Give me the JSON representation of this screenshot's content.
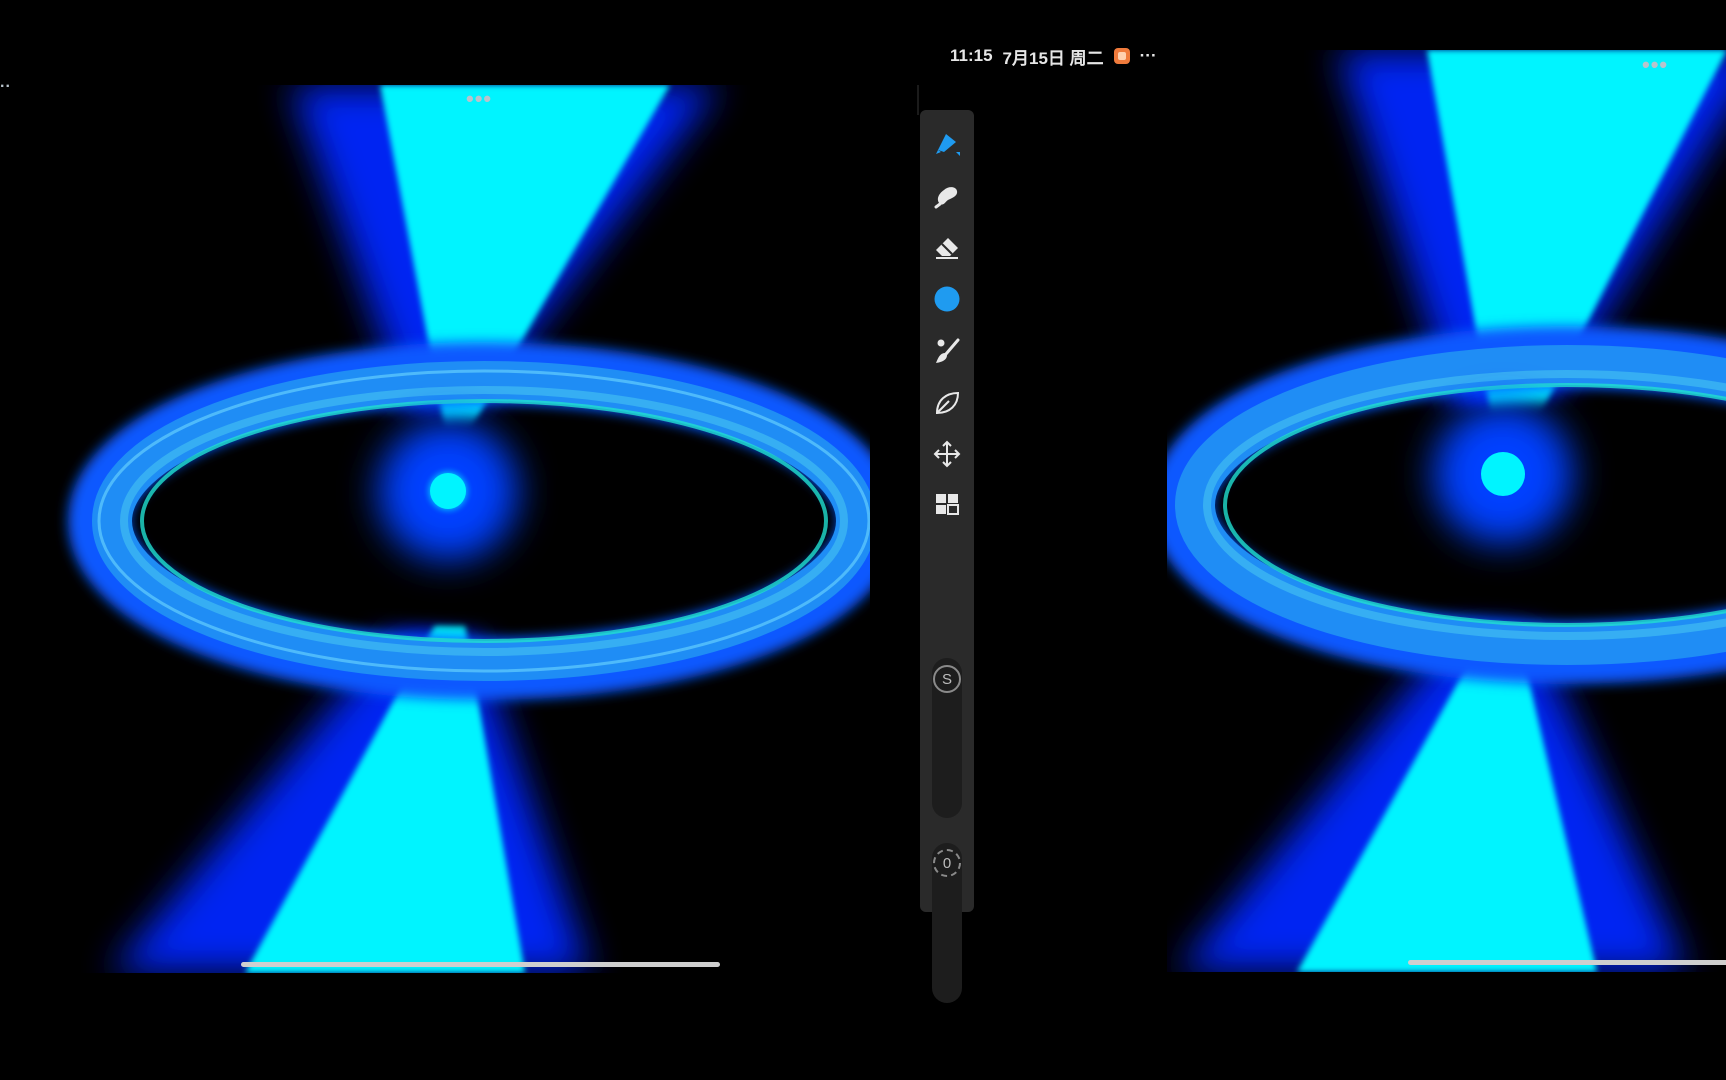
{
  "status_bar": {
    "time": "11:15",
    "date": "7月15日 周二",
    "more": "···"
  },
  "left_pane": {
    "more_dots": "•••",
    "edge_dots": ".."
  },
  "right_pane": {
    "more_dots": "•••"
  },
  "toolbar": {
    "tools": [
      {
        "id": "brush",
        "icon": "brush-icon",
        "active": true
      },
      {
        "id": "smudge",
        "icon": "smudge-icon"
      },
      {
        "id": "eraser",
        "icon": "eraser-icon"
      },
      {
        "id": "color",
        "icon": "color-swatch",
        "color": "#1f9bf0"
      },
      {
        "id": "brush-library",
        "icon": "brush-library-icon"
      },
      {
        "id": "liquify",
        "icon": "leaf-icon"
      },
      {
        "id": "transform",
        "icon": "move-icon"
      },
      {
        "id": "layers",
        "icon": "layers-icon"
      }
    ],
    "size_label": "S",
    "opacity_label": "0"
  },
  "colors": {
    "accent": "#1f9bf0",
    "cyan": "#00f0ff",
    "deep_blue": "#0030ff",
    "toolbar_bg": "#2a2a2a"
  }
}
